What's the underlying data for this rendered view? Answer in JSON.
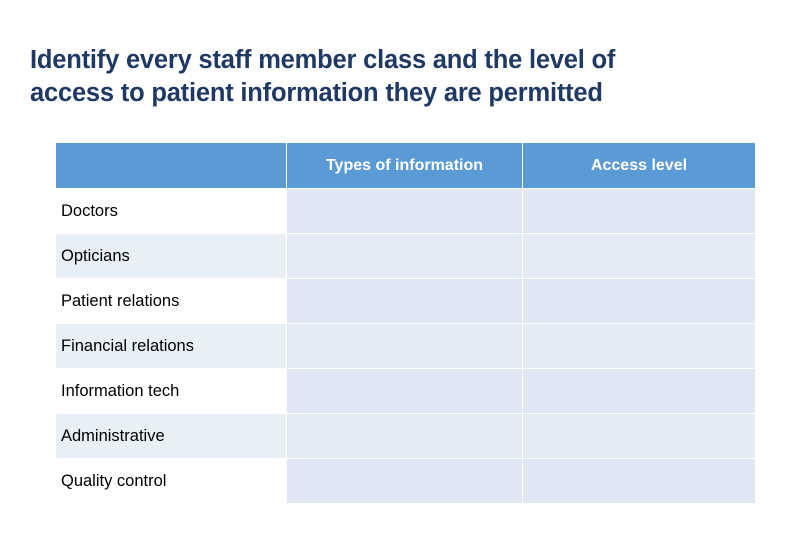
{
  "slide": {
    "title_lines": [
      "Identify every staff member class and the level of",
      "access to patient information they are permitted"
    ],
    "title_color": "#1F3864",
    "header_bg": "#5B9BD5",
    "cell_bg": "#DEE7F3",
    "cell_bg_alt": "#E4EBF5"
  },
  "table": {
    "headers": [
      "",
      "Types of information",
      "Access level"
    ],
    "rows": [
      {
        "label": "Doctors",
        "types_of_information": "",
        "access_level": ""
      },
      {
        "label": "Opticians",
        "types_of_information": "",
        "access_level": ""
      },
      {
        "label": "Patient relations",
        "types_of_information": "",
        "access_level": ""
      },
      {
        "label": "Financial relations",
        "types_of_information": "",
        "access_level": ""
      },
      {
        "label": "Information tech",
        "types_of_information": "",
        "access_level": ""
      },
      {
        "label": "Administrative",
        "types_of_information": "",
        "access_level": ""
      },
      {
        "label": "Quality control",
        "types_of_information": "",
        "access_level": ""
      }
    ]
  }
}
